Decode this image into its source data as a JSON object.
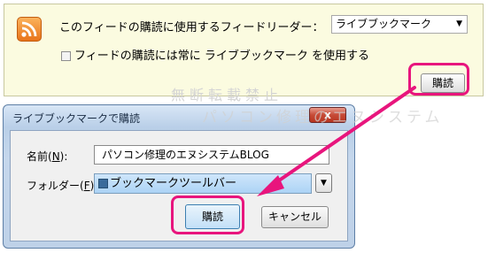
{
  "subscribe_bar": {
    "label": "このフィードの購読に使用するフィードリーダー：",
    "reader_value": "ライブブックマーク",
    "always_label": "フィードの購読には常に ライブブックマーク を使用する",
    "subscribe_button": "購読"
  },
  "watermark": {
    "text": "無断転載禁止",
    "text2": "パソコン修理のエヌシステム"
  },
  "dialog": {
    "title": "ライブブックマークで購読",
    "close_label": "x",
    "name_label_prefix": "名前(",
    "name_label_key": "N",
    "name_label_suffix": "):",
    "name_value": "パソコン修理のエヌシステムBLOG",
    "folder_label_prefix": "フォルダー(",
    "folder_label_key": "F",
    "folder_label_suffix": "):",
    "folder_value": "ブックマークツールバー",
    "ok_button": "購読",
    "cancel_button": "キャンセル"
  },
  "colors": {
    "highlight": "#e8157d",
    "bar_background": "#fbfbe0"
  },
  "icons": [
    "rss-feed-icon",
    "dropdown-arrow-icon",
    "checkbox-icon",
    "close-icon",
    "folder-icon",
    "expand-icon",
    "arrow-annotation-icon"
  ]
}
